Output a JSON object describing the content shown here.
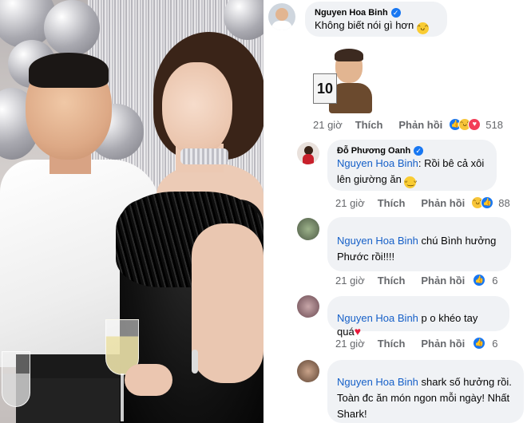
{
  "photo": {
    "alt_icon": "party-photo"
  },
  "comments": [
    {
      "author": "Nguyen Hoa Binh",
      "verified": true,
      "text": "Không biết nói gì hơn",
      "emoji": "grin-sweat",
      "sticker": {
        "card": "10"
      },
      "time": "21 giờ",
      "like_label": "Thích",
      "reply_label": "Phản hồi",
      "reactions": [
        "like",
        "haha",
        "love"
      ],
      "count": "518"
    },
    {
      "author": "Đỗ Phương Oanh",
      "verified": true,
      "mention": "Nguyen Hoa Binh",
      "text": ": Rồi bê cả xôi lên giường ăn",
      "emoji": "relieved",
      "time": "21 giờ",
      "like_label": "Thích",
      "reply_label": "Phản hồi",
      "reactions": [
        "haha",
        "like"
      ],
      "count": "88"
    },
    {
      "mention": "Nguyen Hoa Binh",
      "text": " chú Bình hưởng Phước rồi!!!!",
      "time": "21 giờ",
      "like_label": "Thích",
      "reply_label": "Phản hồi",
      "reactions": [
        "like"
      ],
      "count": "6"
    },
    {
      "mention": "Nguyen Hoa Binh",
      "text": " p o khéo tay quá",
      "heart": "♥",
      "time": "21 giờ",
      "like_label": "Thích",
      "reply_label": "Phản hồi",
      "reactions": [
        "like"
      ],
      "count": "6"
    },
    {
      "mention": "Nguyen Hoa Binh",
      "text": " shark số hưởng rồi. Toàn đc ăn món ngon mỗi ngày! Nhất Shark!"
    }
  ],
  "colors": {
    "mention": "#1660c8",
    "bubble": "#f0f2f5",
    "meta": "#65676b",
    "like": "#1877f2"
  }
}
